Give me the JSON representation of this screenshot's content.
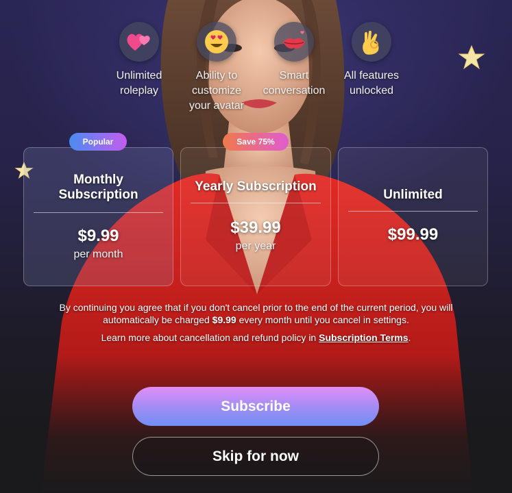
{
  "features": [
    {
      "icon": "two-hearts-emoji-icon",
      "label_line1": "Unlimited",
      "label_line2": "roleplay",
      "label_line3": ""
    },
    {
      "icon": "heart-eyes-emoji-icon",
      "label_line1": "Ability to",
      "label_line2": "customize",
      "label_line3": "your avatar"
    },
    {
      "icon": "kiss-mark-emoji-icon",
      "label_line1": "Smart",
      "label_line2": "conversation",
      "label_line3": ""
    },
    {
      "icon": "ok-hand-emoji-icon",
      "label_line1": "All features",
      "label_line2": "unlocked",
      "label_line3": ""
    }
  ],
  "badges": {
    "popular": "Popular",
    "save": "Save 75%"
  },
  "plans": [
    {
      "title_line1": "Monthly",
      "title_line2": "Subscription",
      "price": "$9.99",
      "period": "per month"
    },
    {
      "title_line1": "Yearly Subscription",
      "title_line2": "",
      "price": "$39.99",
      "period": "per year"
    },
    {
      "title_line1": "Unlimited",
      "title_line2": "",
      "price": "$99.99",
      "period": ""
    }
  ],
  "legal": {
    "line1": "By continuing you agree that if you don't cancel prior to the end of the current period, you will",
    "line2_pre": "automatically be charged ",
    "line2_amount": "$9.99",
    "line2_post": " every month until you cancel in settings.",
    "line3_pre": "Learn more about cancellation and refund policy in ",
    "terms_link": "Subscription Terms",
    "line3_post": "."
  },
  "buttons": {
    "subscribe": "Subscribe",
    "skip": "Skip for now"
  },
  "colors": {
    "badge_popular": "#4a8cf0",
    "badge_save": "#f07a4a",
    "subscribe_top": "#e08ef5",
    "subscribe_bottom": "#6f8ef5",
    "dress": "#d81e1e"
  }
}
